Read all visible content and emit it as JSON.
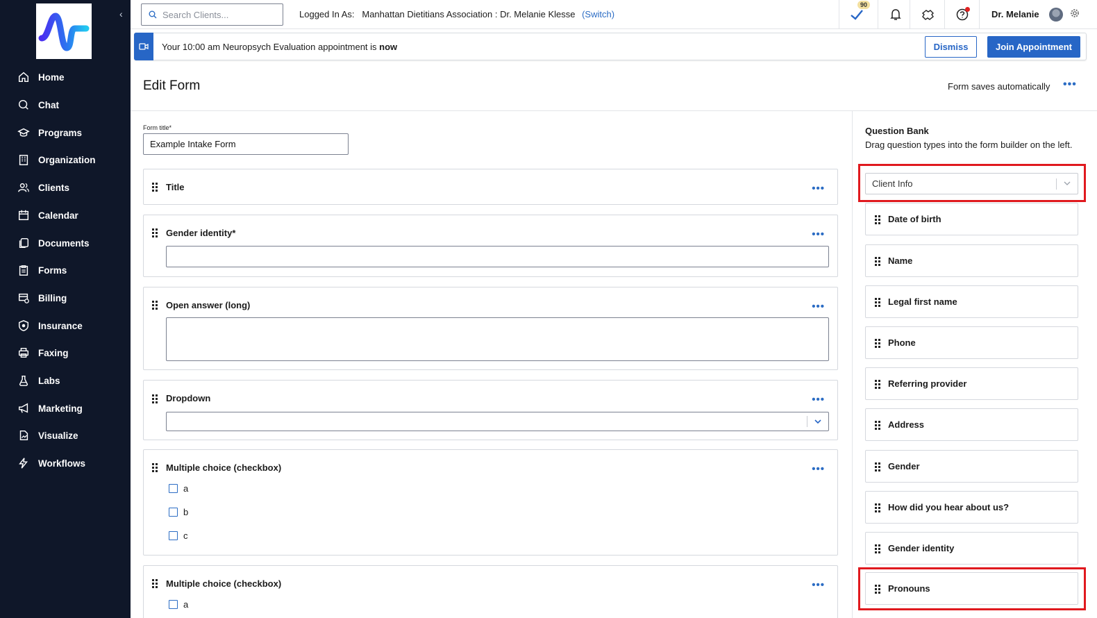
{
  "colors": {
    "sidebar": "#0f1729",
    "accent": "#2766c6",
    "highlight": "#e0191e"
  },
  "sidebar": {
    "items": [
      {
        "label": "Home",
        "icon": "home-icon"
      },
      {
        "label": "Chat",
        "icon": "chat-icon"
      },
      {
        "label": "Programs",
        "icon": "graduation-cap-icon"
      },
      {
        "label": "Organization",
        "icon": "building-icon"
      },
      {
        "label": "Clients",
        "icon": "users-icon"
      },
      {
        "label": "Calendar",
        "icon": "calendar-icon"
      },
      {
        "label": "Documents",
        "icon": "documents-icon"
      },
      {
        "label": "Forms",
        "icon": "clipboard-icon"
      },
      {
        "label": "Billing",
        "icon": "billing-icon"
      },
      {
        "label": "Insurance",
        "icon": "shield-icon"
      },
      {
        "label": "Faxing",
        "icon": "printer-icon"
      },
      {
        "label": "Labs",
        "icon": "flask-icon"
      },
      {
        "label": "Marketing",
        "icon": "megaphone-icon"
      },
      {
        "label": "Visualize",
        "icon": "chart-doc-icon"
      },
      {
        "label": "Workflows",
        "icon": "bolt-icon"
      }
    ]
  },
  "topbar": {
    "search_placeholder": "Search Clients...",
    "logged_in_prefix": "Logged In As:",
    "logged_in_org": "Manhattan Dietitians Association : Dr. Melanie Klesse",
    "switch_label": "(Switch)",
    "tasks_badge": "90",
    "user_name": "Dr. Melanie"
  },
  "banner": {
    "message_prefix": "Your 10:00 am Neuropsych Evaluation appointment is",
    "message_emphasis": "now",
    "dismiss_label": "Dismiss",
    "join_label": "Join Appointment"
  },
  "header": {
    "title": "Edit Form",
    "save_status": "Form saves automatically"
  },
  "form": {
    "title_label": "Form title*",
    "title_value": "Example Intake Form",
    "questions": [
      {
        "label": "Title"
      },
      {
        "label": "Gender identity*"
      },
      {
        "label": "Open answer (long)"
      },
      {
        "label": "Dropdown"
      },
      {
        "label": "Multiple choice (checkbox)",
        "options": [
          "a",
          "b",
          "c"
        ]
      },
      {
        "label": "Multiple choice (checkbox)",
        "options": [
          "a"
        ]
      }
    ]
  },
  "question_bank": {
    "title": "Question Bank",
    "description": "Drag question types into the form builder on the left.",
    "category": "Client Info",
    "items": [
      {
        "label": "Date of birth"
      },
      {
        "label": "Name"
      },
      {
        "label": "Legal first name"
      },
      {
        "label": "Phone"
      },
      {
        "label": "Referring provider"
      },
      {
        "label": "Address"
      },
      {
        "label": "Gender"
      },
      {
        "label": "How did you hear about us?"
      },
      {
        "label": "Gender identity"
      },
      {
        "label": "Pronouns"
      }
    ]
  }
}
